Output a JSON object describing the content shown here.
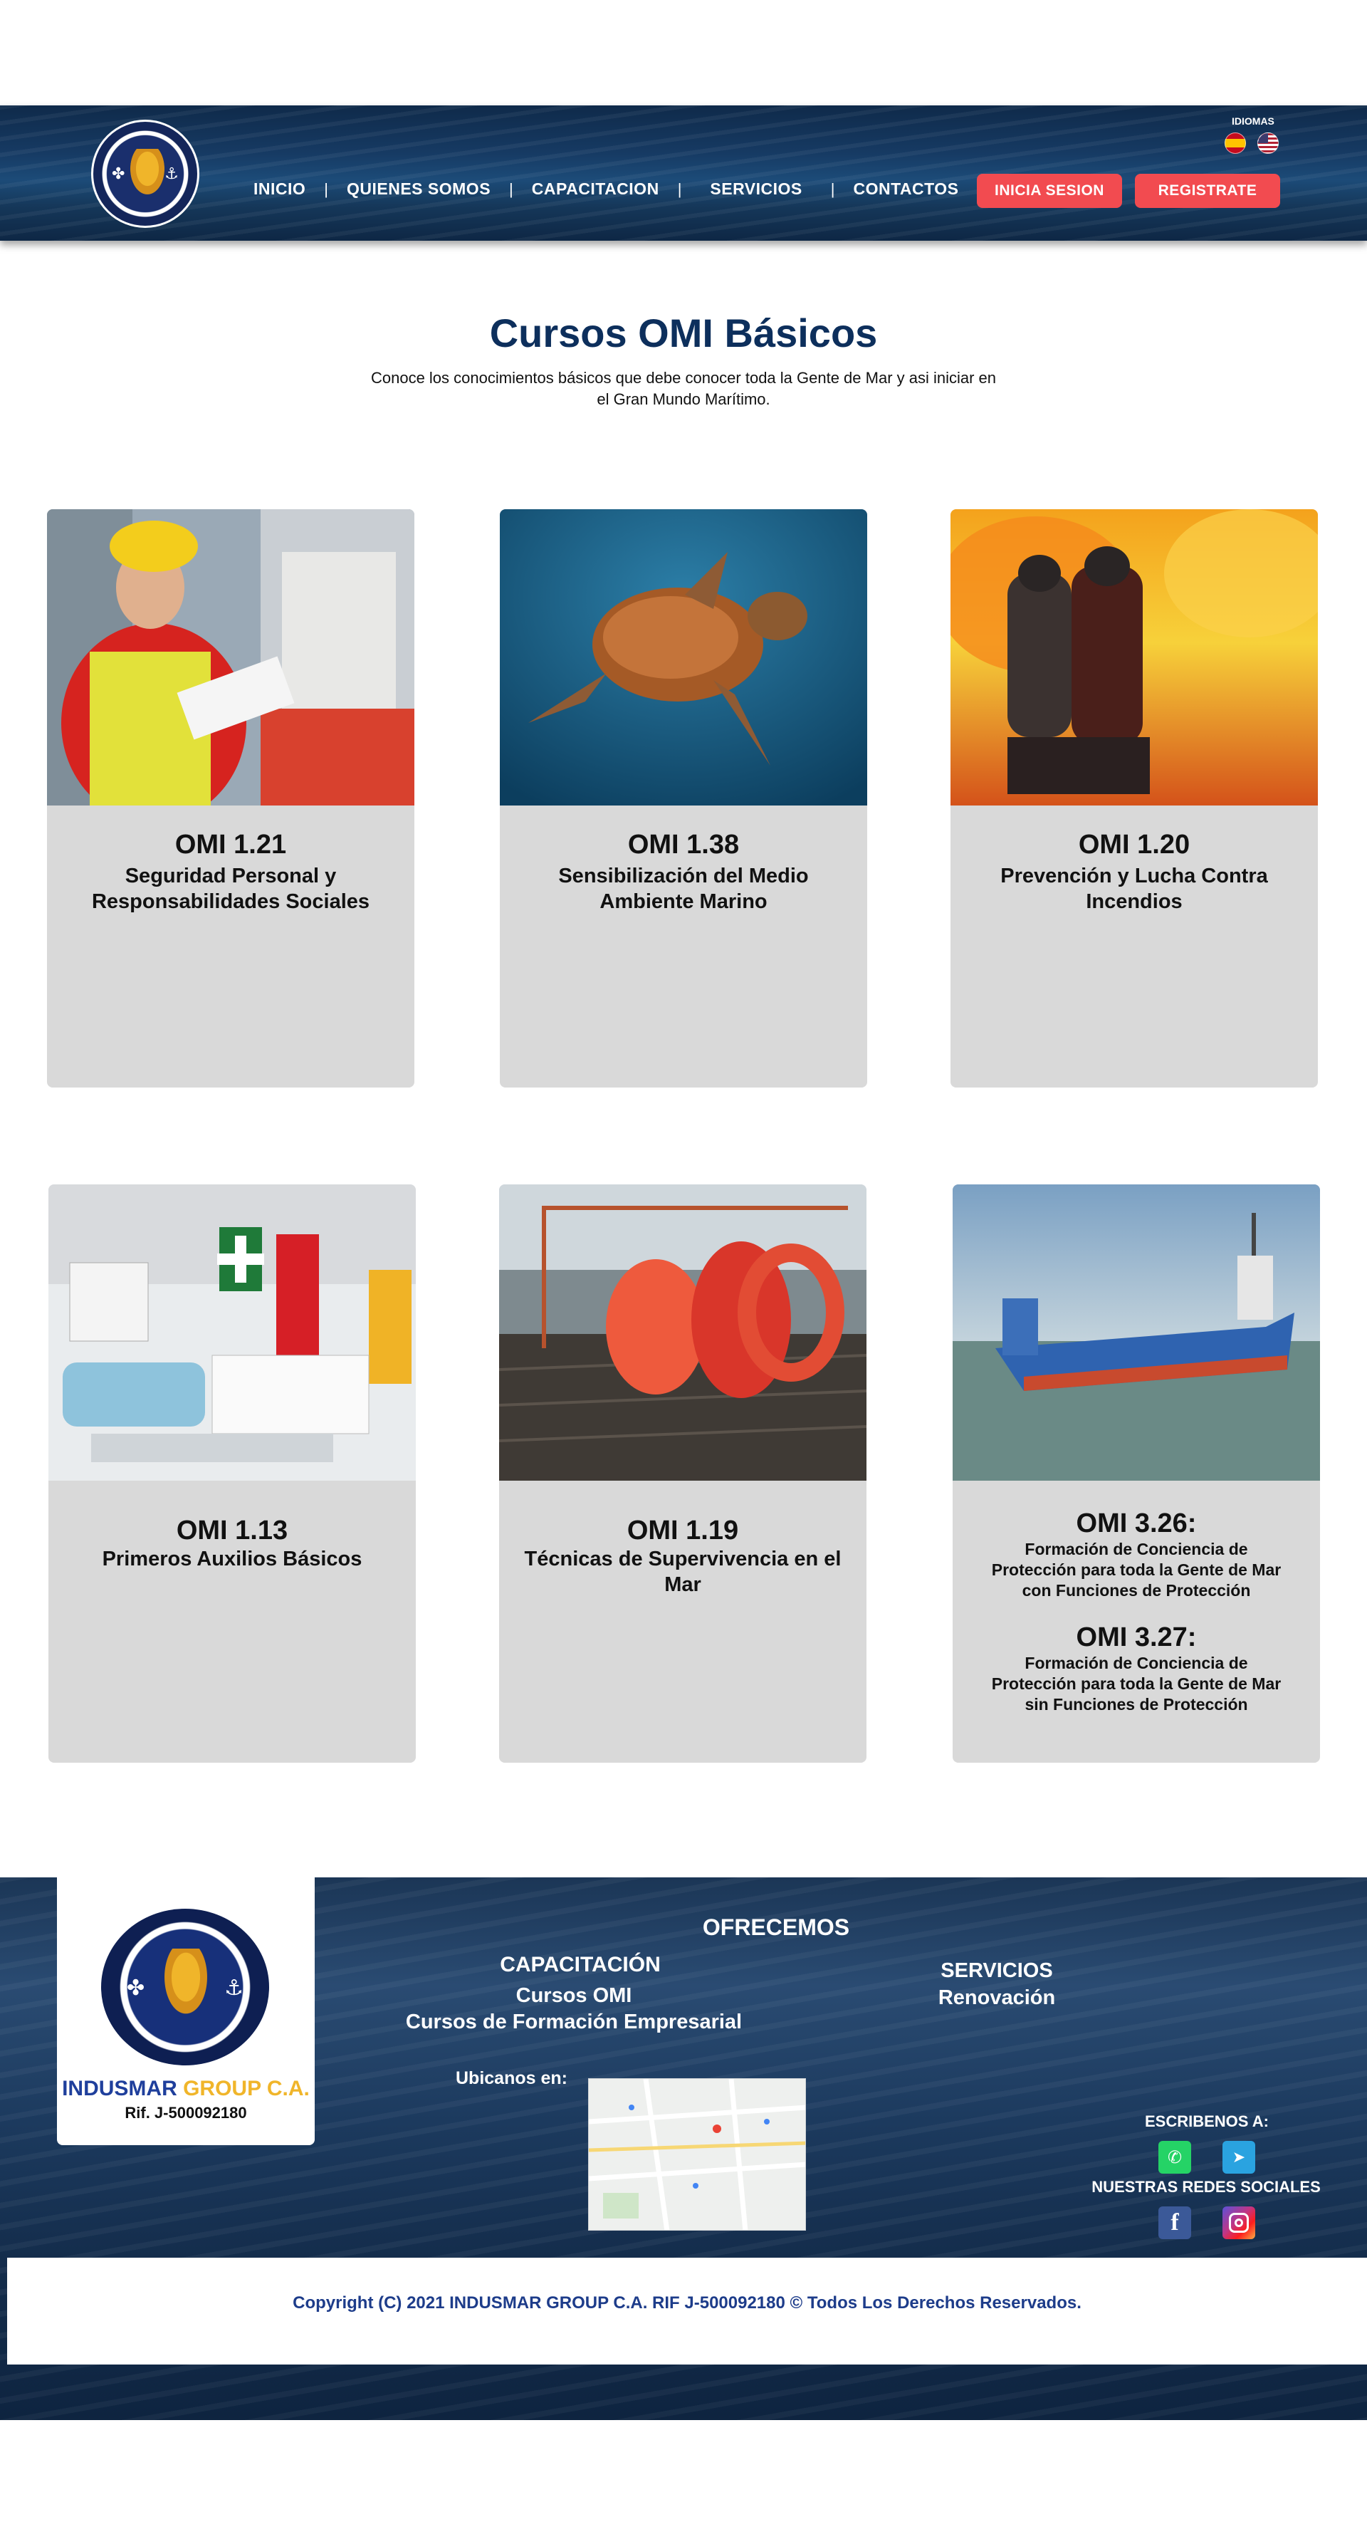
{
  "header": {
    "nav": [
      "INICIO",
      "QUIENES SOMOS",
      "CAPACITACION",
      "SERVICIOS",
      "CONTACTOS"
    ],
    "login_label": "INICIA SESION",
    "register_label": "REGISTRATE",
    "languages_label": "IDIOMAS"
  },
  "main": {
    "title": "Cursos OMI Básicos",
    "subtitle": "Conoce los conocimientos básicos que debe conocer toda la Gente de Mar y asi iniciar en el Gran Mundo Marítimo."
  },
  "courses": [
    {
      "code": "OMI 1.21",
      "name": "Seguridad Personal y Responsabilidades Sociales"
    },
    {
      "code": "OMI 1.38",
      "name": "Sensibilización del Medio Ambiente Marino"
    },
    {
      "code": "OMI 1.20",
      "name": "Prevención y Lucha Contra Incendios"
    },
    {
      "code": "OMI 1.13",
      "name": "Primeros Auxilios Básicos"
    },
    {
      "code": "OMI 1.19",
      "name": "Técnicas de Supervivencia en el Mar"
    },
    {
      "code": "OMI 3.26:",
      "name": "Formación de Conciencia de Protección para toda la Gente de Mar con Funciones de Protección"
    },
    {
      "code": "OMI 3.27:",
      "name": "Formación de Conciencia de Protección para toda la Gente de Mar sin Funciones de Protección"
    }
  ],
  "footer": {
    "company_name_a": "INDUSMAR",
    "company_name_b": "GROUP C.A.",
    "rif": "Rif. J-500092180",
    "offer_heading": "OFRECEMOS",
    "capacitacion": "CAPACITACIÓN",
    "cursos_omi": "Cursos OMI",
    "cursos_empresariales": "Cursos de Formación Empresarial",
    "servicios": "SERVICIOS",
    "renovacion": "Renovación",
    "ubicanos": "Ubicanos en:",
    "escribenos": "ESCRIBENOS A:",
    "redes": "NUESTRAS REDES SOCIALES",
    "copyright": "Copyright (C) 2021 INDUSMAR GROUP C.A. RIF J-500092180 © Todos Los Derechos Reservados."
  }
}
